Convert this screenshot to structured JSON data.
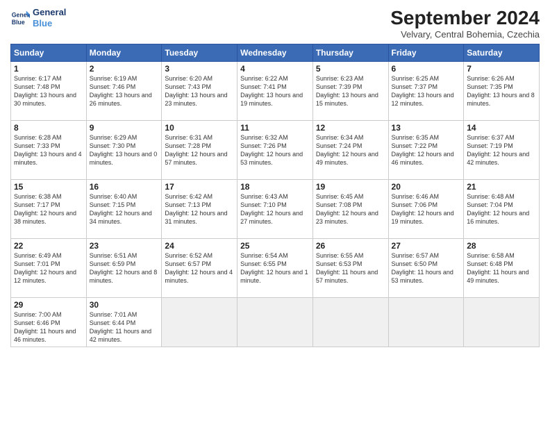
{
  "logo": {
    "line1": "General",
    "line2": "Blue"
  },
  "title": "September 2024",
  "location": "Velvary, Central Bohemia, Czechia",
  "days_header": [
    "Sunday",
    "Monday",
    "Tuesday",
    "Wednesday",
    "Thursday",
    "Friday",
    "Saturday"
  ],
  "weeks": [
    [
      {
        "day": "1",
        "sunrise": "6:17 AM",
        "sunset": "7:48 PM",
        "daylight": "13 hours and 30 minutes."
      },
      {
        "day": "2",
        "sunrise": "6:19 AM",
        "sunset": "7:46 PM",
        "daylight": "13 hours and 26 minutes."
      },
      {
        "day": "3",
        "sunrise": "6:20 AM",
        "sunset": "7:43 PM",
        "daylight": "13 hours and 23 minutes."
      },
      {
        "day": "4",
        "sunrise": "6:22 AM",
        "sunset": "7:41 PM",
        "daylight": "13 hours and 19 minutes."
      },
      {
        "day": "5",
        "sunrise": "6:23 AM",
        "sunset": "7:39 PM",
        "daylight": "13 hours and 15 minutes."
      },
      {
        "day": "6",
        "sunrise": "6:25 AM",
        "sunset": "7:37 PM",
        "daylight": "13 hours and 12 minutes."
      },
      {
        "day": "7",
        "sunrise": "6:26 AM",
        "sunset": "7:35 PM",
        "daylight": "13 hours and 8 minutes."
      }
    ],
    [
      {
        "day": "8",
        "sunrise": "6:28 AM",
        "sunset": "7:33 PM",
        "daylight": "13 hours and 4 minutes."
      },
      {
        "day": "9",
        "sunrise": "6:29 AM",
        "sunset": "7:30 PM",
        "daylight": "13 hours and 0 minutes."
      },
      {
        "day": "10",
        "sunrise": "6:31 AM",
        "sunset": "7:28 PM",
        "daylight": "12 hours and 57 minutes."
      },
      {
        "day": "11",
        "sunrise": "6:32 AM",
        "sunset": "7:26 PM",
        "daylight": "12 hours and 53 minutes."
      },
      {
        "day": "12",
        "sunrise": "6:34 AM",
        "sunset": "7:24 PM",
        "daylight": "12 hours and 49 minutes."
      },
      {
        "day": "13",
        "sunrise": "6:35 AM",
        "sunset": "7:22 PM",
        "daylight": "12 hours and 46 minutes."
      },
      {
        "day": "14",
        "sunrise": "6:37 AM",
        "sunset": "7:19 PM",
        "daylight": "12 hours and 42 minutes."
      }
    ],
    [
      {
        "day": "15",
        "sunrise": "6:38 AM",
        "sunset": "7:17 PM",
        "daylight": "12 hours and 38 minutes."
      },
      {
        "day": "16",
        "sunrise": "6:40 AM",
        "sunset": "7:15 PM",
        "daylight": "12 hours and 34 minutes."
      },
      {
        "day": "17",
        "sunrise": "6:42 AM",
        "sunset": "7:13 PM",
        "daylight": "12 hours and 31 minutes."
      },
      {
        "day": "18",
        "sunrise": "6:43 AM",
        "sunset": "7:10 PM",
        "daylight": "12 hours and 27 minutes."
      },
      {
        "day": "19",
        "sunrise": "6:45 AM",
        "sunset": "7:08 PM",
        "daylight": "12 hours and 23 minutes."
      },
      {
        "day": "20",
        "sunrise": "6:46 AM",
        "sunset": "7:06 PM",
        "daylight": "12 hours and 19 minutes."
      },
      {
        "day": "21",
        "sunrise": "6:48 AM",
        "sunset": "7:04 PM",
        "daylight": "12 hours and 16 minutes."
      }
    ],
    [
      {
        "day": "22",
        "sunrise": "6:49 AM",
        "sunset": "7:01 PM",
        "daylight": "12 hours and 12 minutes."
      },
      {
        "day": "23",
        "sunrise": "6:51 AM",
        "sunset": "6:59 PM",
        "daylight": "12 hours and 8 minutes."
      },
      {
        "day": "24",
        "sunrise": "6:52 AM",
        "sunset": "6:57 PM",
        "daylight": "12 hours and 4 minutes."
      },
      {
        "day": "25",
        "sunrise": "6:54 AM",
        "sunset": "6:55 PM",
        "daylight": "12 hours and 1 minute."
      },
      {
        "day": "26",
        "sunrise": "6:55 AM",
        "sunset": "6:53 PM",
        "daylight": "11 hours and 57 minutes."
      },
      {
        "day": "27",
        "sunrise": "6:57 AM",
        "sunset": "6:50 PM",
        "daylight": "11 hours and 53 minutes."
      },
      {
        "day": "28",
        "sunrise": "6:58 AM",
        "sunset": "6:48 PM",
        "daylight": "11 hours and 49 minutes."
      }
    ],
    [
      {
        "day": "29",
        "sunrise": "7:00 AM",
        "sunset": "6:46 PM",
        "daylight": "11 hours and 46 minutes."
      },
      {
        "day": "30",
        "sunrise": "7:01 AM",
        "sunset": "6:44 PM",
        "daylight": "11 hours and 42 minutes."
      },
      null,
      null,
      null,
      null,
      null
    ]
  ]
}
